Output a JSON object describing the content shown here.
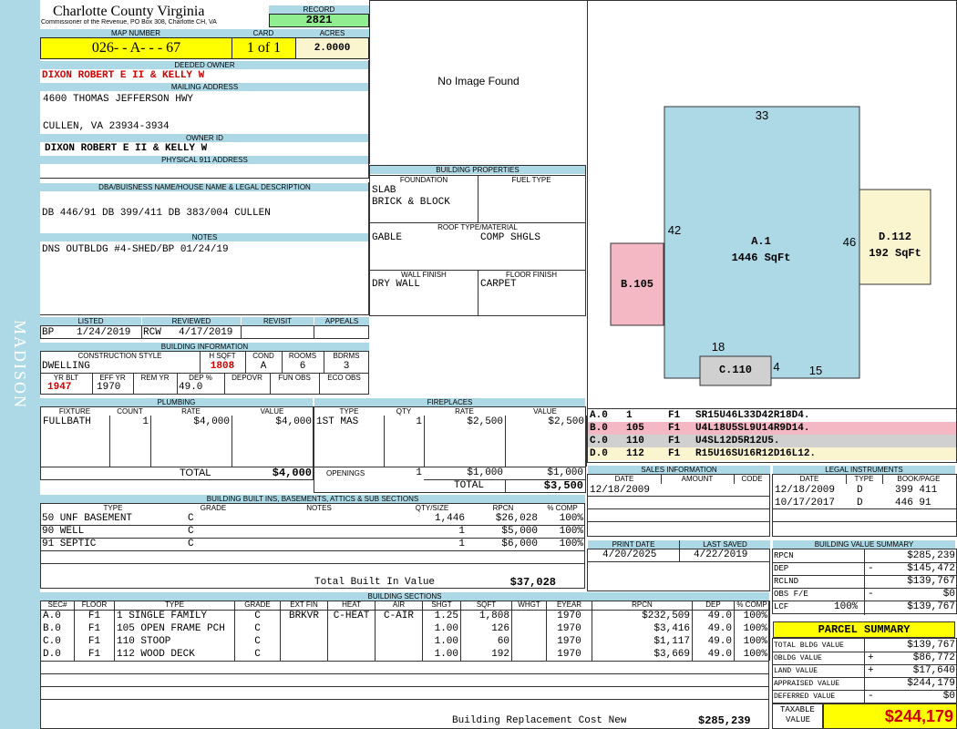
{
  "county": {
    "title": "Charlotte County Virginia",
    "subtitle": "Commissioner of the Revenue, PO Box 308, Charlotte CH, VA"
  },
  "district": "MADISON",
  "record": {
    "label": "RECORD",
    "value": "2821"
  },
  "map": {
    "label": "MAP NUMBER",
    "value": "026- - A-  -  - 67"
  },
  "card": {
    "label": "CARD",
    "value": "1 of 1"
  },
  "acres": {
    "label": "ACRES",
    "value": "2.0000"
  },
  "owner": {
    "label": "DEEDED OWNER",
    "value": "DIXON ROBERT E II & KELLY W"
  },
  "mailing": {
    "label": "MAILING ADDRESS",
    "line1": "4600 THOMAS JEFFERSON HWY",
    "line2": "CULLEN, VA 23934-3934"
  },
  "owner_id": {
    "label": "OWNER ID",
    "value": "DIXON ROBERT E II & KELLY W"
  },
  "physical": {
    "label": "PHYSICAL 911 ADDRESS",
    "value": ""
  },
  "dba": {
    "label": "DBA/BUISNESS NAME/HOUSE NAME & LEGAL DESCRIPTION",
    "value": "DB 446/91 DB 399/411 DB 383/004 CULLEN"
  },
  "notes": {
    "label": "NOTES",
    "value": "DNS OUTBLDG #4-SHED/BP 01/24/19"
  },
  "image": {
    "text": "No Image Found"
  },
  "building_props": {
    "label": "BUILDING PROPERTIES",
    "foundation_label": "FOUNDATION",
    "fuel_label": "FUEL TYPE",
    "foundation": [
      "SLAB",
      "BRICK & BLOCK"
    ],
    "fuel": "",
    "roof_label": "ROOF TYPE/MATERIAL",
    "roof_type": "GABLE",
    "roof_material": "COMP SHGLS",
    "wall_label": "WALL FINISH",
    "floor_label": "FLOOR FINISH",
    "wall": "DRY WALL",
    "floor": "CARPET"
  },
  "status": {
    "listed_label": "LISTED",
    "reviewed_label": "REVIEWED",
    "revisit_label": "REVISIT",
    "appeals_label": "APPEALS",
    "listed_by": "BP",
    "listed_date": "1/24/2019",
    "reviewed_by": "RCW",
    "reviewed_date": "4/17/2019",
    "revisit": "",
    "appeals": ""
  },
  "building_info": {
    "label": "BUILDING INFORMATION",
    "headers": {
      "style": "CONSTRUCTION STYLE",
      "hsqft": "H SQFT",
      "cond": "COND",
      "rooms": "ROOMS",
      "bdrms": "BDRMS"
    },
    "style": "DWELLING",
    "hsqft": "1808",
    "cond": "A",
    "rooms": "6",
    "bdrms": "3",
    "headers2": {
      "yrblt": "YR BLT",
      "effyr": "EFF YR",
      "remyr": "REM YR",
      "dep": "DEP %",
      "depovr": "DEPOVR",
      "funobs": "FUN OBS",
      "ecoobs": "ECO OBS"
    },
    "yrblt": "1947",
    "effyr": "1970",
    "remyr": "",
    "dep": "49.0",
    "depovr": "",
    "funobs": "",
    "ecoobs": ""
  },
  "plumbing": {
    "label": "PLUMBING",
    "headers": [
      "FIXTURE",
      "COUNT",
      "RATE",
      "VALUE"
    ],
    "rows": [
      [
        "FULLBATH",
        "1",
        "$4,000",
        "$4,000"
      ],
      [
        "",
        "",
        "",
        ""
      ],
      [
        "",
        "",
        "",
        ""
      ],
      [
        "",
        "",
        "",
        ""
      ]
    ],
    "total_label": "TOTAL",
    "total": "$4,000"
  },
  "fireplaces": {
    "label": "FIREPLACES",
    "headers": [
      "TYPE",
      "QTY",
      "RATE",
      "VALUE"
    ],
    "rows": [
      [
        "1ST MAS",
        "1",
        "$2,500",
        "$2,500"
      ],
      [
        "",
        "",
        "",
        ""
      ],
      [
        "",
        "",
        "",
        ""
      ],
      [
        "",
        "",
        "",
        ""
      ]
    ],
    "openings_label": "OPENINGS",
    "openings_qty": "1",
    "openings_rate": "$1,000",
    "openings_value": "$1,000",
    "total_label": "TOTAL",
    "total": "$3,500"
  },
  "builtins": {
    "label": "BUILDING BUILT INS, BASEMENTS, ATTICS & SUB SECTIONS",
    "headers": [
      "TYPE",
      "GRADE",
      "NOTES",
      "QTY/SIZE",
      "RPCN",
      "% COMP"
    ],
    "rows": [
      [
        "50 UNF BASEMENT",
        "C",
        "",
        "1,446",
        "$26,028",
        "100%"
      ],
      [
        "90 WELL",
        "C",
        "",
        "1",
        "$5,000",
        "100%"
      ],
      [
        "91 SEPTIC",
        "C",
        "",
        "1",
        "$6,000",
        "100%"
      ]
    ],
    "total_label": "Total Built In Value",
    "total": "$37,028"
  },
  "sections": {
    "label": "BUILDING SECTIONS",
    "headers": [
      "SEC#",
      "FLOOR",
      "TYPE",
      "GRADE",
      "EXT FIN",
      "HEAT",
      "AIR",
      "SHGT",
      "SQFT",
      "WHGT",
      "EYEAR",
      "RPCN",
      "DEP",
      "% COMP"
    ],
    "rows": [
      [
        "A.0",
        "F1",
        "1 SINGLE FAMILY",
        "C",
        "BRKVR",
        "C-HEAT",
        "C-AIR",
        "1.25",
        "1,808",
        "",
        "1970",
        "$232,509",
        "49.0",
        "100%"
      ],
      [
        "B.0",
        "F1",
        "105 OPEN FRAME PCH",
        "C",
        "",
        "",
        "",
        "1.00",
        "126",
        "",
        "1970",
        "$3,416",
        "49.0",
        "100%"
      ],
      [
        "C.0",
        "F1",
        "110 STOOP",
        "C",
        "",
        "",
        "",
        "1.00",
        "60",
        "",
        "1970",
        "$1,117",
        "49.0",
        "100%"
      ],
      [
        "D.0",
        "F1",
        "112 WOOD DECK",
        "C",
        "",
        "",
        "",
        "1.00",
        "192",
        "",
        "1970",
        "$3,669",
        "49.0",
        "100%"
      ]
    ],
    "total_label": "Building Replacement Cost New",
    "total": "$285,239"
  },
  "sketch": {
    "a_label": "A.1",
    "a_area": "1446 SqFt",
    "b_label": "B.105",
    "c_label": "C.110",
    "d_label": "D.112",
    "d_area": "192 SqFt",
    "dim_top": "33",
    "dim_left": "42",
    "dim_right": "46",
    "dim_18": "18",
    "dim_4": "4",
    "dim_15": "15",
    "colors": {
      "a": "#add8e6",
      "b": "#f4b8c4",
      "c": "#d0d0d0",
      "d": "#fbf5cf"
    }
  },
  "sketch_legend": [
    {
      "sec": "A.0",
      "code": "1",
      "floor": "F1",
      "vectors": "SR15U46L33D42R18D4.",
      "color": "#ffffff"
    },
    {
      "sec": "B.0",
      "code": "105",
      "floor": "F1",
      "vectors": "U4L18U5SL9U14R9D14.",
      "color": "#f4b8c4"
    },
    {
      "sec": "C.0",
      "code": "110",
      "floor": "F1",
      "vectors": "U4SL12D5R12U5.",
      "color": "#d0d0d0"
    },
    {
      "sec": "D.0",
      "code": "112",
      "floor": "F1",
      "vectors": "R15U16SU16R12D16L12.",
      "color": "#fbf5cf"
    }
  ],
  "sales": {
    "label": "SALES INFORMATION",
    "headers": [
      "DATE",
      "AMOUNT",
      "CODE"
    ],
    "rows": [
      [
        "12/18/2009",
        "",
        ""
      ]
    ]
  },
  "legal": {
    "label": "LEGAL INSTRUMENTS",
    "headers": [
      "DATE",
      "TYPE",
      "BOOK/PAGE"
    ],
    "rows": [
      [
        "12/18/2009",
        "D",
        "399 411"
      ],
      [
        "10/17/2017",
        "D",
        "446 91"
      ]
    ]
  },
  "print": {
    "print_label": "PRINT DATE",
    "saved_label": "LAST SAVED",
    "print_date": "4/20/2025",
    "saved_date": "4/22/2019"
  },
  "value_summary": {
    "label": "BUILDING VALUE SUMMARY",
    "rows": [
      {
        "label": "RPCN",
        "sign": "",
        "value": "$285,239"
      },
      {
        "label": "DEP",
        "sign": "-",
        "value": "$145,472"
      },
      {
        "label": "RCLND",
        "sign": "",
        "value": "$139,767"
      },
      {
        "label": "OBS F/E",
        "sign": "-",
        "value": "$0"
      },
      {
        "label": "LCF",
        "pct": "100%",
        "sign": "",
        "value": "$139,767"
      }
    ]
  },
  "parcel": {
    "title": "PARCEL SUMMARY",
    "rows": [
      {
        "label": "TOTAL BLDG VALUE",
        "sign": "",
        "value": "$139,767"
      },
      {
        "label": "OBLDG VALUE",
        "sign": "+",
        "value": "$86,772"
      },
      {
        "label": "LAND VALUE",
        "sign": "+",
        "value": "$17,640"
      },
      {
        "label": "APPRAISED VALUE",
        "sign": "",
        "value": "$244,179"
      },
      {
        "label": "DEFERRED VALUE",
        "sign": "-",
        "value": "$0"
      }
    ],
    "taxable_label1": "TAXABLE",
    "taxable_label2": "VALUE",
    "taxable": "$244,179"
  }
}
